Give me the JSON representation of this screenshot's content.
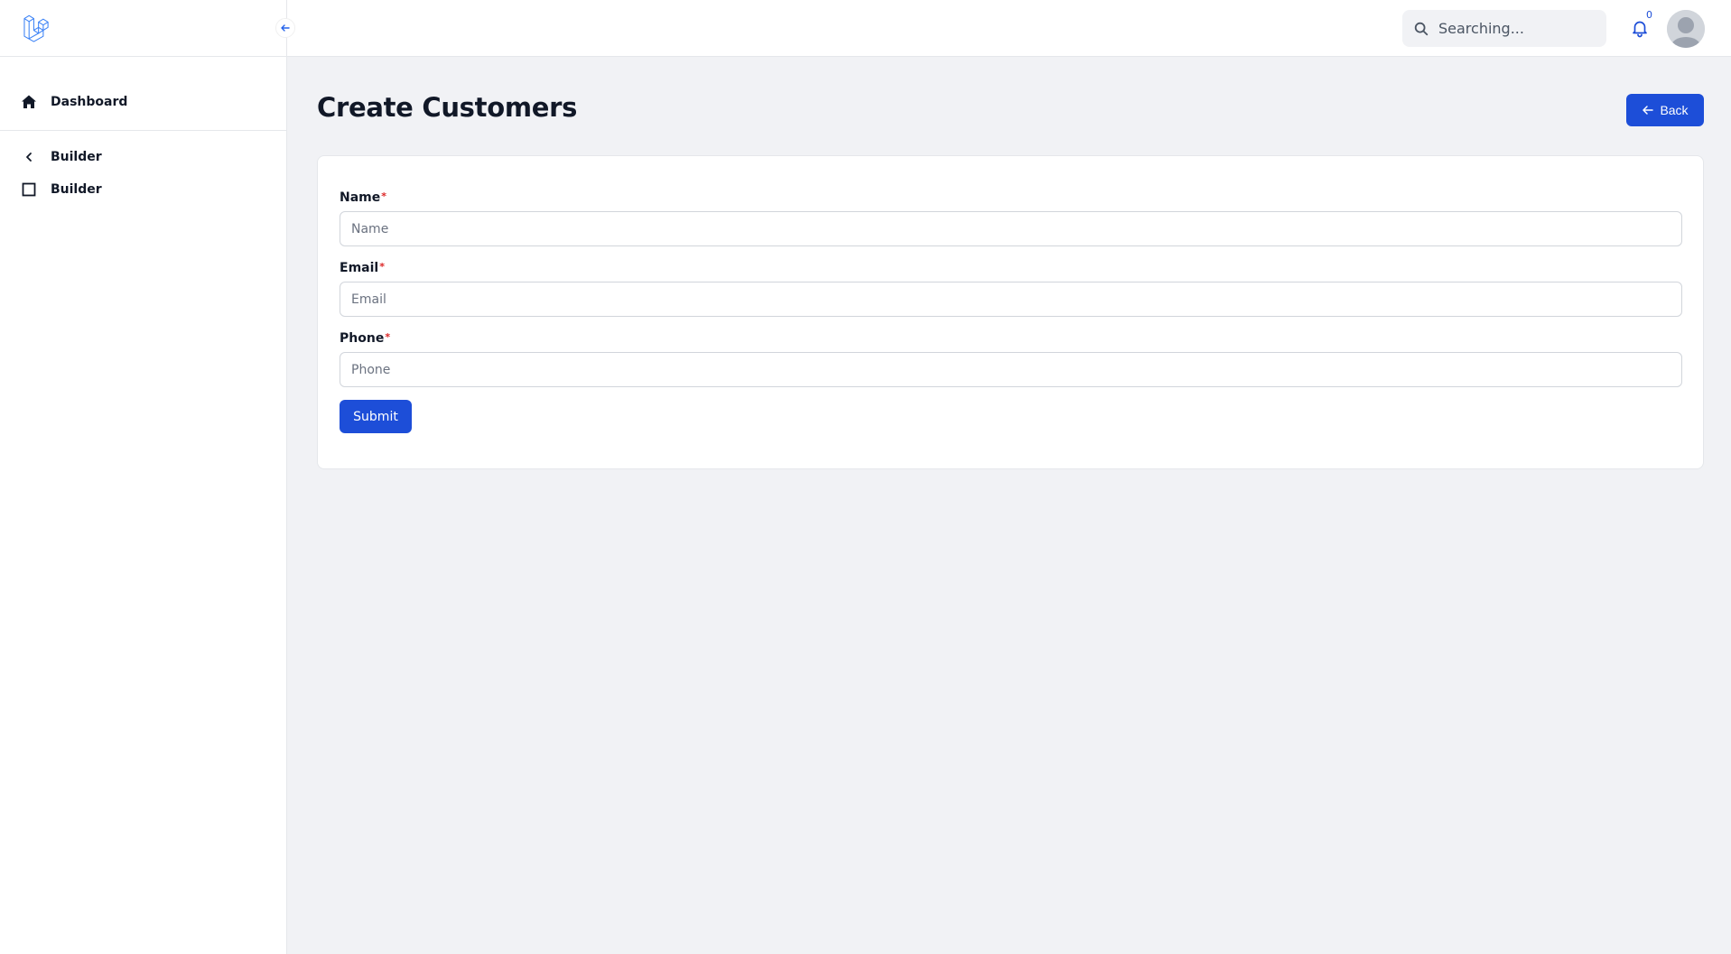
{
  "sidebar": {
    "items": [
      {
        "label": "Dashboard",
        "icon": "home-icon"
      },
      {
        "label": "Builder",
        "icon": "chevron-left-icon"
      },
      {
        "label": "Builder",
        "icon": "square-icon"
      }
    ]
  },
  "topbar": {
    "search_placeholder": "Searching...",
    "notification_count": "0"
  },
  "main": {
    "title": "Create Customers",
    "back_label": "Back",
    "form": {
      "fields": [
        {
          "label": "Name",
          "placeholder": "Name",
          "required_mark": "*"
        },
        {
          "label": "Email",
          "placeholder": "Email",
          "required_mark": "*"
        },
        {
          "label": "Phone",
          "placeholder": "Phone",
          "required_mark": "*"
        }
      ],
      "submit_label": "Submit"
    }
  },
  "colors": {
    "accent": "#1d4ed8",
    "background": "#f1f2f5",
    "required": "#dc2626"
  }
}
